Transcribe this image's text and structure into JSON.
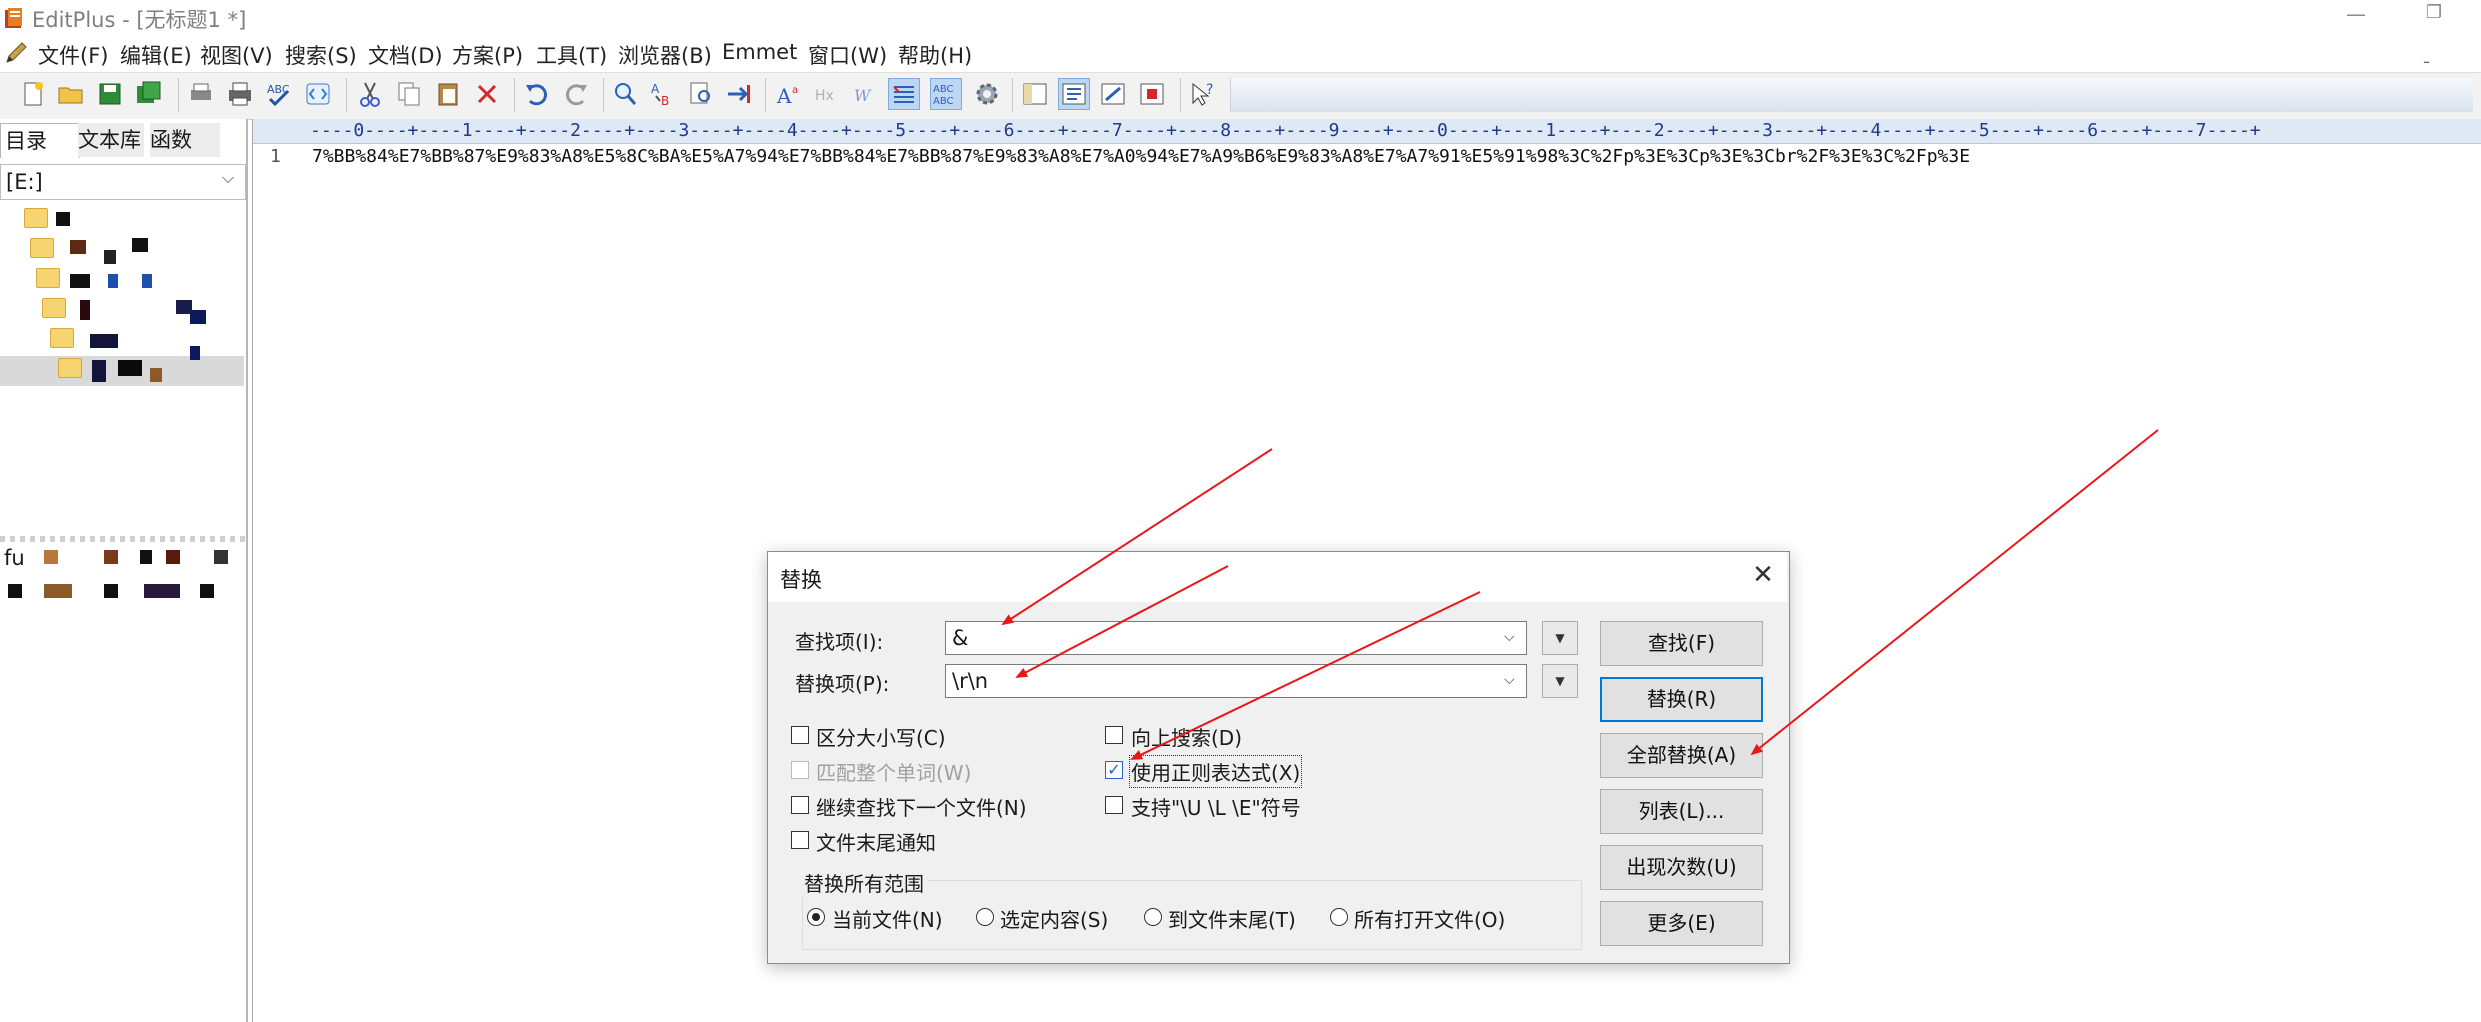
{
  "window": {
    "title": "EditPlus - [无标题1 *]",
    "minimize_glyph": "—",
    "maximize_glyph": "❐"
  },
  "menu": {
    "items": [
      "文件(F)",
      "编辑(E)",
      "视图(V)",
      "搜索(S)",
      "文档(D)",
      "方案(P)",
      "工具(T)",
      "浏览器(B)",
      "Emmet",
      "窗口(W)",
      "帮助(H)"
    ],
    "mdi_restore_glyph": "ˍ"
  },
  "left_panel": {
    "tabs": [
      "目录",
      "文本库",
      "函数"
    ],
    "drive": "[E:]",
    "drive_arrow": "⌵",
    "file_prefix": "fu"
  },
  "ruler": {
    "text": "----0----+----1----+----2----+----3----+----4----+----5----+----6----+----7----+----8----+----9----+----0----+----1----+----2----+----3----+----4----+----5----+----6----+----7----+"
  },
  "editor": {
    "line_number": "1",
    "line_text": "7%BB%84%E7%BB%87%E9%83%A8%E5%8C%BA%E5%A7%94%E7%BB%84%E7%BB%87%E9%83%A8%E7%A0%94%E7%A9%B6%E9%83%A8%E7%A7%91%E5%91%98%3C%2Fp%3E%3Cp%3E%3Cbr%2F%3E%3C%2Fp%3E"
  },
  "dialog": {
    "title": "替换",
    "close_glyph": "✕",
    "find_label": "查找项(I):",
    "find_value": "&",
    "replace_label": "替换项(P):",
    "replace_value": "\\r\\n",
    "combo_arrow": "⌵",
    "side_arrow": "▼",
    "options": {
      "match_case": "区分大小写(C)",
      "whole_word": "匹配整个单词(W)",
      "continue_next_file": "继续查找下一个文件(N)",
      "end_of_file_notify": "文件末尾通知",
      "search_up": "向上搜索(D)",
      "use_regex": "使用正则表达式(X)",
      "support_ule": "支持\"\\U \\L \\E\"符号"
    },
    "check_mark": "✓",
    "scope_title": "替换所有范围",
    "scope_options": [
      "当前文件(N)",
      "选定内容(S)",
      "到文件末尾(T)",
      "所有打开文件(O)"
    ],
    "buttons": {
      "find": "查找(F)",
      "replace": "替换(R)",
      "replace_all": "全部替换(A)",
      "list": "列表(L)...",
      "count": "出现次数(U)",
      "more": "更多(E)"
    }
  },
  "colors": {
    "arrow": "#e81818",
    "accent": "#0078d7"
  }
}
